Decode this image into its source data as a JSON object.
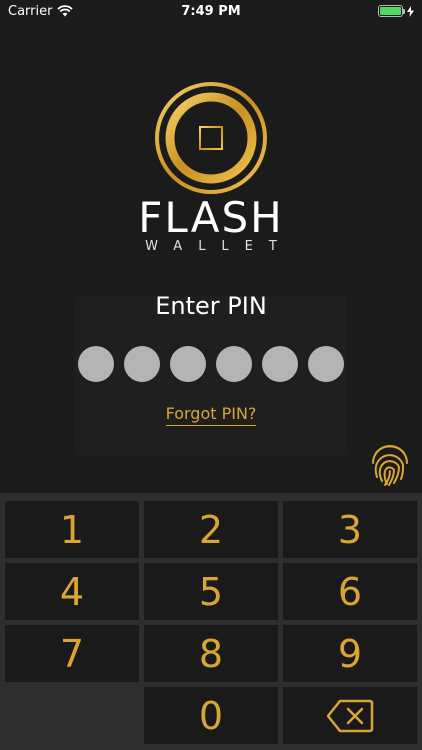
{
  "status_bar": {
    "carrier": "Carrier",
    "time": "7:49 PM",
    "battery_level": 1.0
  },
  "logo": {
    "title": "FLASH",
    "subtitle": "WALLET"
  },
  "pin": {
    "title": "Enter PIN",
    "digits_total": 6,
    "forgot_label": "Forgot PIN?"
  },
  "keypad": {
    "keys": [
      "1",
      "2",
      "3",
      "4",
      "5",
      "6",
      "7",
      "8",
      "9",
      "",
      "0",
      "⌫"
    ]
  },
  "colors": {
    "accent": "#d9a534",
    "background": "#1b1b1b",
    "keypad_bg": "#2e2e2e",
    "key_bg": "#1a1a1a",
    "dot": "#b4b4b4"
  }
}
